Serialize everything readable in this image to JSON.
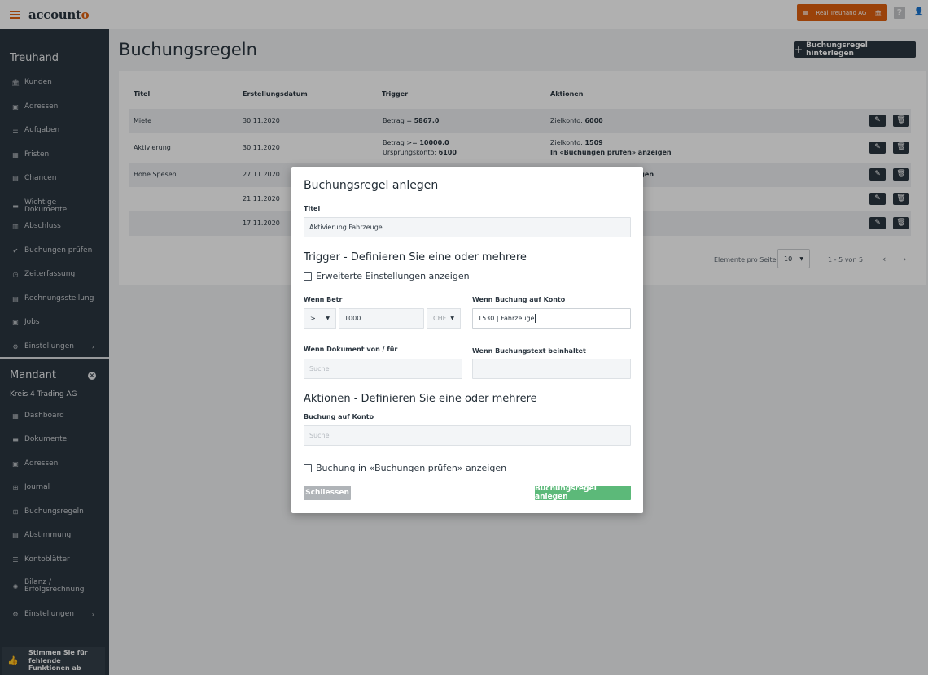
{
  "topbar": {
    "logo_main": "account",
    "logo_accent": "o",
    "tenant_label": "Real Treuhand AG",
    "help_label": "?",
    "icons": {
      "menu": "hamburger-icon",
      "tenant": "building-icon",
      "help": "help-icon",
      "user": "user-icon"
    }
  },
  "sidebar": {
    "section1_title": "Treuhand",
    "section1_items": [
      {
        "label": "Kunden",
        "icon": "bank-icon",
        "glyph": "🏛"
      },
      {
        "label": "Adressen",
        "icon": "address-book-icon",
        "glyph": "▣"
      },
      {
        "label": "Aufgaben",
        "icon": "tasks-icon",
        "glyph": "☰"
      },
      {
        "label": "Fristen",
        "icon": "calendar-icon",
        "glyph": "▦"
      },
      {
        "label": "Chancen",
        "icon": "opportunity-icon",
        "glyph": "▤"
      },
      {
        "label": "Wichtige Dokumente",
        "icon": "inbox-icon",
        "glyph": "▬"
      },
      {
        "label": "Abschluss",
        "icon": "book-icon",
        "glyph": "▥"
      },
      {
        "label": "Buchungen prüfen",
        "icon": "check-double-icon",
        "glyph": "✔"
      },
      {
        "label": "Zeiterfassung",
        "icon": "clock-icon",
        "glyph": "◷"
      },
      {
        "label": "Rechnungsstellung",
        "icon": "invoice-icon",
        "glyph": "▤"
      },
      {
        "label": "Jobs",
        "icon": "briefcase-icon",
        "glyph": "▣"
      },
      {
        "label": "Einstellungen",
        "icon": "gear-icon",
        "glyph": "⚙",
        "chevron": "›"
      }
    ],
    "section2_title": "Mandant",
    "client_name": "Kreis 4 Trading AG",
    "section2_items": [
      {
        "label": "Dashboard",
        "icon": "dashboard-icon",
        "glyph": "▦"
      },
      {
        "label": "Dokumente",
        "icon": "inbox-icon",
        "glyph": "▬"
      },
      {
        "label": "Adressen",
        "icon": "address-book-icon",
        "glyph": "▣"
      },
      {
        "label": "Journal",
        "icon": "table-icon",
        "glyph": "⊞"
      },
      {
        "label": "Buchungsregeln",
        "icon": "table-icon",
        "glyph": "⊞"
      },
      {
        "label": "Abstimmung",
        "icon": "reconcile-icon",
        "glyph": "▤"
      },
      {
        "label": "Kontoblätter",
        "icon": "list-icon",
        "glyph": "☰"
      },
      {
        "label": "Bilanz / Erfolgsrechnung",
        "icon": "balance-icon",
        "glyph": "✺"
      },
      {
        "label": "Einstellungen",
        "icon": "gear-icon",
        "glyph": "⚙",
        "chevron": "›"
      }
    ],
    "vote_text": "Stimmen Sie für fehlende Funktionen ab"
  },
  "main": {
    "title": "Buchungsregeln",
    "add_button": "Buchungsregel hinterlegen",
    "table": {
      "headers": [
        "Titel",
        "Erstellungsdatum",
        "Trigger",
        "Aktionen"
      ],
      "rows": [
        {
          "title": "Miete",
          "date": "30.11.2020",
          "trigger_l1_pre": "Betrag = ",
          "trigger_l1_val": "5867.0",
          "trigger_l2_pre": "",
          "trigger_l2_val": "",
          "action_l1_pre": "Zielkonto: ",
          "action_l1_val": "6000",
          "action_l2": ""
        },
        {
          "title": "Aktivierung",
          "date": "30.11.2020",
          "trigger_l1_pre": "Betrag >= ",
          "trigger_l1_val": "10000.0",
          "trigger_l2_pre": "Ursprungskonto: ",
          "trigger_l2_val": "6100",
          "action_l1_pre": "Zielkonto: ",
          "action_l1_val": "1509",
          "action_l2": "In «Buchungen prüfen» anzeigen"
        },
        {
          "title": "Hohe Spesen",
          "date": "27.11.2020",
          "trigger_l1_pre": "",
          "trigger_l1_val": "",
          "trigger_l2_pre": "",
          "trigger_l2_val": "",
          "action_l1_pre": "",
          "action_l1_val": "",
          "action_l2": "eigen"
        },
        {
          "title": "",
          "date": "21.11.2020",
          "trigger_l1_pre": "",
          "trigger_l1_val": "",
          "trigger_l2_pre": "",
          "trigger_l2_val": "",
          "action_l1_pre": "",
          "action_l1_val": "",
          "action_l2": ""
        },
        {
          "title": "",
          "date": "17.11.2020",
          "trigger_l1_pre": "",
          "trigger_l1_val": "",
          "trigger_l2_pre": "",
          "trigger_l2_val": "",
          "action_l1_pre": "",
          "action_l1_val": "",
          "action_l2": ""
        }
      ]
    },
    "pager": {
      "label": "Elemente pro Seite:",
      "page_size": "10",
      "range": "1 - 5 von 5",
      "prev": "‹",
      "next": "›"
    }
  },
  "modal": {
    "title": "Buchungsregel anlegen",
    "titel_label": "Titel",
    "titel_value": "Aktivierung Fahrzeuge",
    "trigger_heading": "Trigger - Definieren Sie eine oder mehrere",
    "advanced_checkbox": "Erweiterte Einstellungen anzeigen",
    "amount_label": "Wenn Betr",
    "amount_operator": ">",
    "amount_value": "1000",
    "currency": "CHF",
    "account_label": "Wenn Buchung auf Konto",
    "account_value": "1530 | Fahrzeuge",
    "document_label": "Wenn Dokument von / für",
    "document_placeholder": "Suche",
    "text_label": "Wenn Buchungstext beinhaltet",
    "text_value": "",
    "actions_heading": "Aktionen - Definieren Sie eine oder mehrere",
    "target_label": "Buchung auf Konto",
    "target_placeholder": "Suche",
    "review_checkbox": "Buchung in «Buchungen prüfen» anzeigen",
    "close_button": "Schliessen",
    "create_button": "Buchungsregel anlegen"
  },
  "colors": {
    "brand_orange": "#e0600f",
    "sidebar_bg": "#2b3640",
    "success_green": "#5cb979"
  }
}
